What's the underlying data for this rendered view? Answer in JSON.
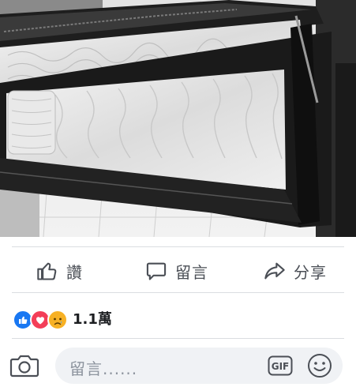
{
  "post": {
    "photo_icon": "casket-photo"
  },
  "actions": {
    "like": {
      "label": "讚",
      "icon": "thumbs-up-icon"
    },
    "comment": {
      "label": "留言",
      "icon": "speech-bubble-icon"
    },
    "share": {
      "label": "分享",
      "icon": "share-arrow-icon"
    }
  },
  "reactions": {
    "icons": [
      "like-reaction-icon",
      "love-reaction-icon",
      "sad-reaction-icon"
    ],
    "count": "1.1萬",
    "colors": {
      "like": "#1877f2",
      "love": "#f33e58",
      "sad": "#f7b125"
    }
  },
  "comment_box": {
    "placeholder": "留言......",
    "camera_icon": "camera-icon",
    "gif_label": "GIF",
    "emoji_icon": "smiley-icon"
  }
}
